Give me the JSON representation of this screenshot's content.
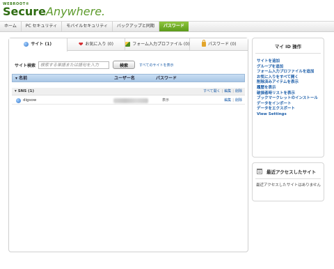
{
  "brand": {
    "small": "WEBROOT®",
    "main_bold": "Secure",
    "main_italic": "Anywhere."
  },
  "nav": [
    "ホーム",
    "PC セキュリティ",
    "モバイルセキュリティ",
    "バックアップと同期",
    "パスワード"
  ],
  "tabs": [
    {
      "label": "サイト (1)",
      "icon": "globe-icon"
    },
    {
      "label": "お気に入り (0)",
      "icon": "heart-icon"
    },
    {
      "label": "フォーム入力プロファイル (0)",
      "icon": "pen-icon"
    },
    {
      "label": "パスワード (0)",
      "icon": "lock-icon"
    }
  ],
  "search": {
    "label": "サイト検索",
    "placeholder": "検索する単語または語句を入力",
    "button": "検索",
    "show_all": "すべてのサイトを表示"
  },
  "table": {
    "columns": [
      "名前",
      "ユーザー名",
      "パスワード"
    ],
    "group": {
      "label": "SNS (1)",
      "open_all": "すべて開く",
      "edit": "編集",
      "delete": "削除"
    },
    "rows": [
      {
        "name": "digsow",
        "password_action": "表示",
        "edit": "編集",
        "delete": "削除"
      }
    ]
  },
  "sidebar": {
    "title": "マイ ID 操作",
    "links": [
      "サイトを追加",
      "グループを追加",
      "フォーム入力プロファイルを追加",
      "お気に入りをすべて開く",
      "削除済みアイテムを表示",
      "履歴を表示",
      "破損者時リストを表示",
      "ブックマークレットのインストール",
      "データをインポート",
      "データをエクスポート",
      "View Settings"
    ]
  },
  "recent": {
    "title": "最近アクセスしたサイト",
    "empty_text": "最近アクセスしたサイトはありません"
  },
  "colors": {
    "accent_green": "#6aa822",
    "link_blue": "#1a5ca8",
    "header_blue": "#b8d2ec"
  }
}
